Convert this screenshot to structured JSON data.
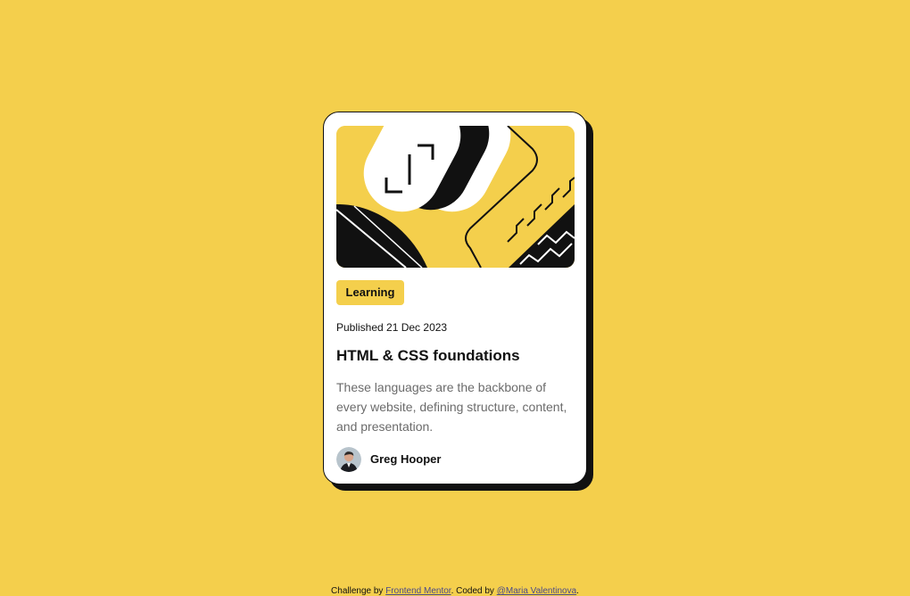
{
  "theme": {
    "background": "#F4CF4C",
    "card_background": "#FFFFFF",
    "ink": "#111111",
    "muted_text": "#6B6B6B",
    "link": "#4B4B8A"
  },
  "card": {
    "illustration": "abstract-pattern-illustration",
    "tag": "Learning",
    "published": "Published 21 Dec 2023",
    "title": "HTML & CSS foundations",
    "description": "These languages are the backbone of every website, defining structure, content, and presentation.",
    "author": {
      "avatar": "avatar-icon",
      "name": "Greg Hooper"
    }
  },
  "attribution": {
    "prefix": "Challenge by ",
    "challenge_link": "Frontend Mentor",
    "middle": ". Coded by ",
    "author_link": "@Maria Valentinova",
    "suffix": "."
  }
}
